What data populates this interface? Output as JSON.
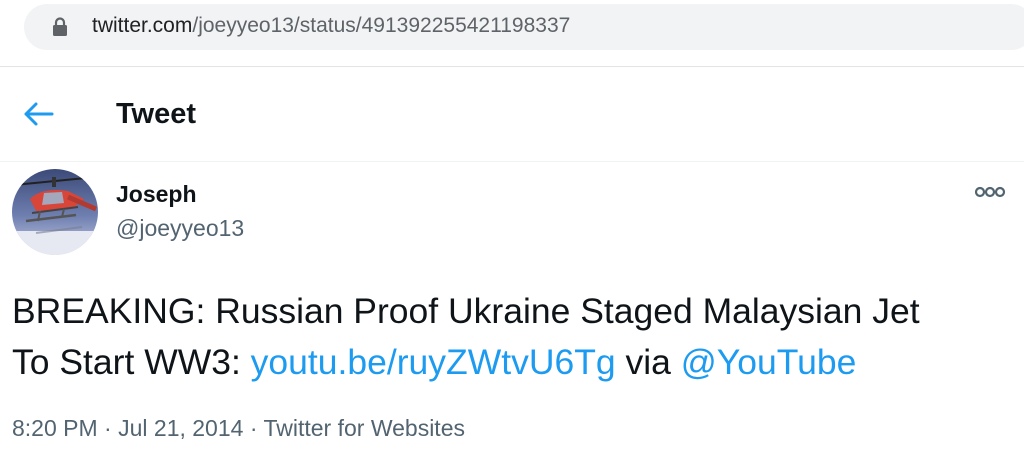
{
  "browser": {
    "url_host": "twitter.com",
    "url_path": "/joeyyeo13/status/491392255421198337",
    "lock_icon": "lock-icon"
  },
  "header": {
    "back_icon": "arrow-left-icon",
    "title": "Tweet",
    "accent_color": "#1d9bf0"
  },
  "tweet": {
    "author": {
      "display_name": "Joseph",
      "handle": "@joeyyeo13",
      "avatar_icon": "helicopter-avatar"
    },
    "more_icon": "more-options-icon",
    "text_line1": "BREAKING: Russian Proof Ukraine Staged Malaysian Jet",
    "text_line2_prefix": "To Start WW3: ",
    "link_text": "youtu.be/ruyZWtvU6Tg",
    "via_text": " via ",
    "mention_text": "@YouTube",
    "time": "8:20 PM",
    "separator": " · ",
    "date": "Jul 21, 2014",
    "source": "Twitter for Websites",
    "link_color": "#1d9bf0"
  }
}
